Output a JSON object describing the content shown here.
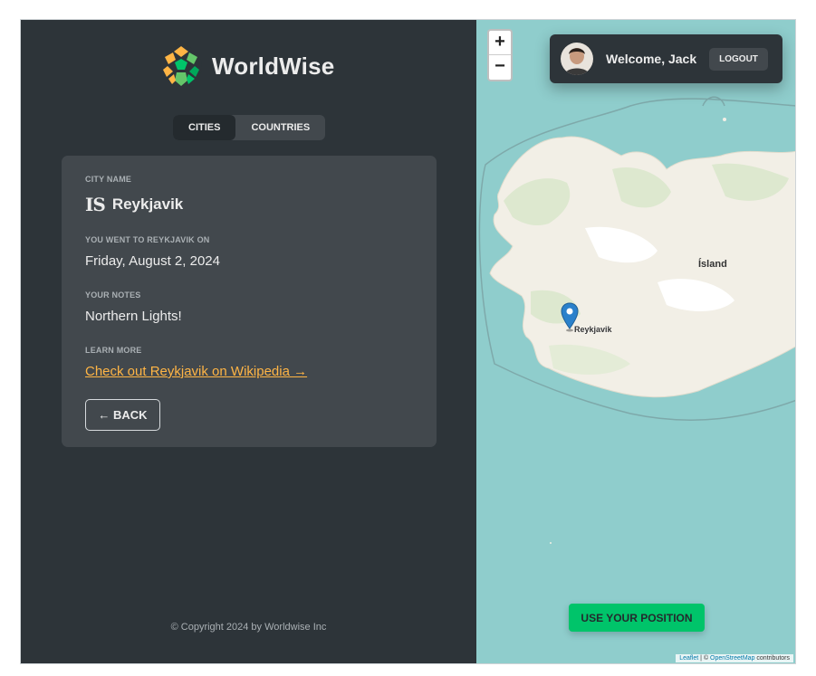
{
  "app": {
    "name": "WorldWise"
  },
  "tabs": [
    {
      "label": "CITIES",
      "active": true
    },
    {
      "label": "COUNTRIES",
      "active": false
    }
  ],
  "city": {
    "name_label": "CITY NAME",
    "flag": "IS",
    "name": "Reykjavik",
    "visited_label": "YOU WENT TO REYKJAVIK ON",
    "visited_date": "Friday, August 2, 2024",
    "notes_label": "YOUR NOTES",
    "notes": "Northern Lights!",
    "learn_label": "LEARN MORE",
    "wiki_link": "Check out Reykjavik on Wikipedia →",
    "back_label": "← BACK"
  },
  "footer": {
    "copyright": "© Copyright 2024 by Worldwise Inc"
  },
  "map": {
    "zoom_in": "+",
    "zoom_out": "−",
    "country_label": "Ísland",
    "city_label": "Reykjavik",
    "use_position": "USE YOUR POSITION",
    "attribution": {
      "leaflet": "Leaflet",
      "sep": " | © ",
      "osm": "OpenStreetMap",
      "suffix": " contributors"
    }
  },
  "user": {
    "welcome": "Welcome, Jack",
    "logout": "LOGOUT"
  },
  "colors": {
    "sidebar_bg": "#2d3439",
    "card_bg": "#42484d",
    "accent_orange": "#ffb545",
    "accent_green": "#00c46a",
    "water": "#8fcdcc"
  }
}
